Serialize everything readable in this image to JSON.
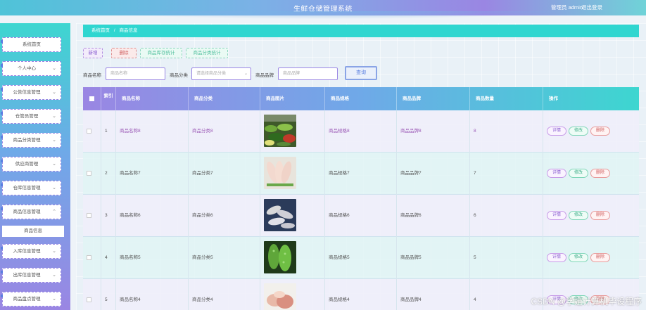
{
  "header": {
    "title": "生鲜仓储管理系统",
    "user": "管理员 admin",
    "logout": "退出登录"
  },
  "sidebar": {
    "items": [
      {
        "label": "系统首页",
        "chevron": ""
      },
      {
        "label": "个人中心",
        "chevron": "⌄"
      },
      {
        "label": "公告信息管理",
        "chevron": "⌄"
      },
      {
        "label": "仓管员管理",
        "chevron": "⌄"
      },
      {
        "label": "商品分类管理",
        "chevron": "⌄"
      },
      {
        "label": "供应商管理",
        "chevron": "⌄"
      },
      {
        "label": "仓库信息管理",
        "chevron": "⌄"
      },
      {
        "label": "商品信息管理",
        "chevron": "⌃"
      },
      {
        "label": "入库信息管理",
        "chevron": "⌄"
      },
      {
        "label": "出库信息管理",
        "chevron": "⌄"
      },
      {
        "label": "商品盘点管理",
        "chevron": "⌄"
      }
    ],
    "submenu": {
      "label": "商品信息"
    }
  },
  "breadcrumb": {
    "home": "系统首页",
    "separator": "/",
    "current": "商品信息"
  },
  "toolbar": {
    "add": "新增",
    "delete": "删除",
    "stat_stock": "商品库存统计",
    "stat_category": "商品分类统计"
  },
  "filters": {
    "name_label": "商品名称",
    "name_placeholder": "商品名称",
    "category_label": "商品分类",
    "category_placeholder": "请选择商品分类",
    "brand_label": "商品品牌",
    "brand_placeholder": "商品品牌",
    "search": "查询"
  },
  "table": {
    "headers": {
      "index": "索引",
      "name": "商品名称",
      "category": "商品分类",
      "image": "商品图片",
      "spec": "商品规格",
      "brand": "商品品牌",
      "quantity": "商品数量",
      "actions": "操作"
    },
    "rows": [
      {
        "index": "1",
        "name": "商品名称8",
        "category": "商品分类8",
        "spec": "商品规格8",
        "brand": "商品品牌8",
        "quantity": "8",
        "image": "vegetables"
      },
      {
        "index": "2",
        "name": "商品名称7",
        "category": "商品分类7",
        "spec": "商品规格7",
        "brand": "商品品牌7",
        "quantity": "7",
        "image": "pig-trotters"
      },
      {
        "index": "3",
        "name": "商品名称6",
        "category": "商品分类6",
        "spec": "商品规格6",
        "brand": "商品品牌6",
        "quantity": "6",
        "image": "shrimp"
      },
      {
        "index": "4",
        "name": "商品名称5",
        "category": "商品分类5",
        "spec": "商品规格5",
        "brand": "商品品牌5",
        "quantity": "5",
        "image": "bitter-melon"
      },
      {
        "index": "5",
        "name": "商品名称4",
        "category": "商品分类4",
        "spec": "商品规格4",
        "brand": "商品品牌4",
        "quantity": "4",
        "image": "meat"
      }
    ],
    "actions": {
      "detail": "详情",
      "edit": "修改",
      "delete": "删除"
    }
  },
  "watermark": "CSDN @学姐计算机毕设程序"
}
